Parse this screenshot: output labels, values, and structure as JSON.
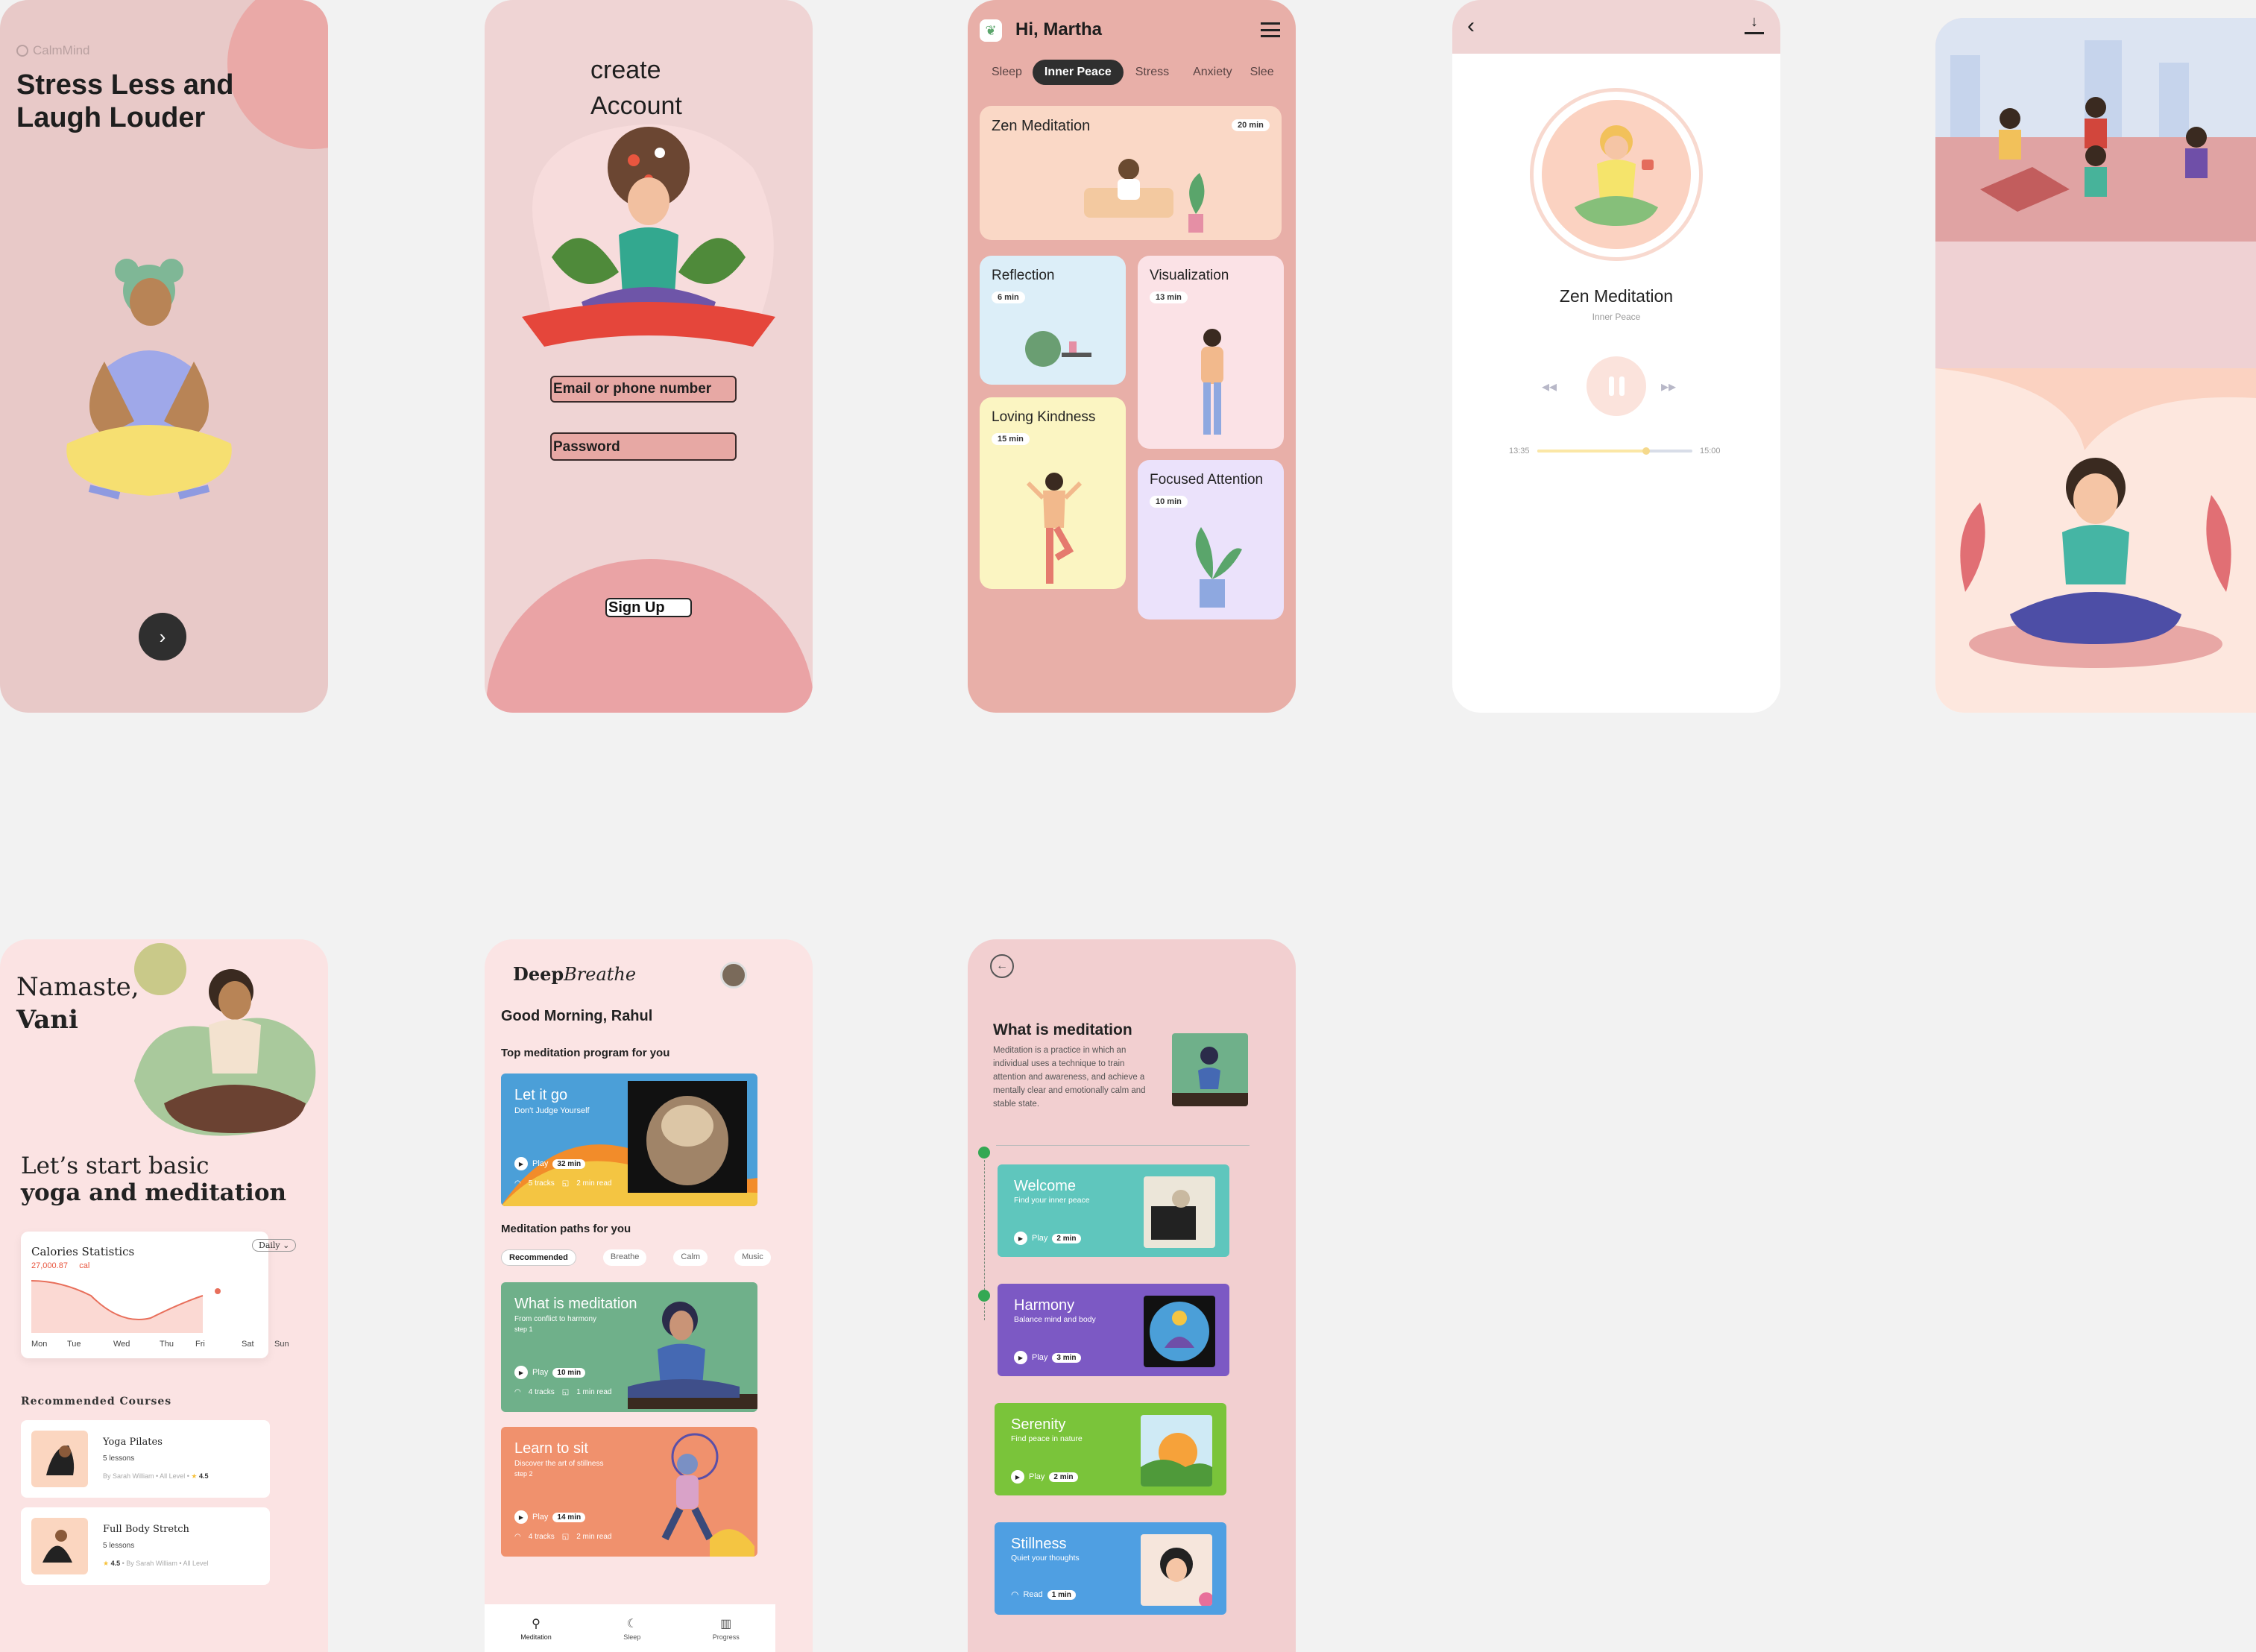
{
  "colors": {
    "background": "#f2f2f2",
    "pink": "#efcfcf",
    "salmon": "#e9b2a9",
    "dark": "#2f2f2f",
    "accent": "#e86f5b"
  },
  "s1": {
    "logo": "CalmMind",
    "title_line1": "Stress Less and",
    "title_line2": "Laugh Louder",
    "next_icon": "chevron-right-icon"
  },
  "s2": {
    "title_line1": "create",
    "title_line2": "Account",
    "email_placeholder": "Email or phone number",
    "password_placeholder": "Password",
    "signup": "Sign Up"
  },
  "s3": {
    "greeting": "Hi, Martha",
    "menu_icon": "hamburger-icon",
    "tabs": [
      "Sleep",
      "Inner Peace",
      "Stress",
      "Anxiety",
      "Slee"
    ],
    "active_tab": "Inner Peace",
    "cards": [
      {
        "title": "Zen Meditation",
        "duration": "20 min"
      },
      {
        "title": "Reflection",
        "duration": "6 min"
      },
      {
        "title": "Visualization",
        "duration": "13 min"
      },
      {
        "title": "Loving Kindness",
        "duration": "15 min"
      },
      {
        "title": "Focused Attention",
        "duration": "10 min"
      }
    ]
  },
  "s4": {
    "title": "Zen Meditation",
    "subtitle": "Inner Peace",
    "time_current": "13:35",
    "time_total": "15:00",
    "progress": 0.7
  },
  "s6": {
    "greeting_line1": "Namaste,",
    "greeting_name": "Vani",
    "headline_line1": "Let’s start basic",
    "headline_line2": "yoga and meditation",
    "stats_title": "Calories Statistics",
    "stats_value": "27,000.87",
    "stats_unit": "cal",
    "stats_filter": "Daily",
    "days": [
      "Mon",
      "Tue",
      "Wed",
      "Thu",
      "Fri",
      "Sat",
      "Sun"
    ],
    "section_title": "Recommended Courses",
    "courses": [
      {
        "title": "Yoga Pilates",
        "lessons": "5 lessons",
        "meta": "By Sarah William  •  All Level  •",
        "rating": "4.5"
      },
      {
        "title": "Full Body Stretch",
        "lessons": "5 lessons",
        "rating": "4.5",
        "meta": "By Sarah William  •  All Level"
      }
    ]
  },
  "s7": {
    "brand_a": "Deep",
    "brand_b": "Breathe",
    "greeting": "Good Morning, Rahul",
    "top_title": "Top meditation program for you",
    "featured": {
      "title": "Let it go",
      "subtitle": "Don't Judge Yourself",
      "play": "Play",
      "duration": "32 min",
      "tracks": "5 tracks",
      "read": "2 min read"
    },
    "paths_title": "Meditation paths for you",
    "chips": [
      "Recommended",
      "Breathe",
      "Calm",
      "Music"
    ],
    "cards": [
      {
        "title": "What is meditation",
        "subtitle": "From conflict to harmony",
        "step": "step 1",
        "play": "Play",
        "duration": "10 min",
        "tracks": "4 tracks",
        "read": "1 min read"
      },
      {
        "title": "Learn to sit",
        "subtitle": "Discover the art of stillness",
        "step": "step 2",
        "play": "Play",
        "duration": "14 min",
        "tracks": "4 tracks",
        "read": "2 min read"
      }
    ],
    "nav": [
      "Meditation",
      "Sleep",
      "Progress"
    ]
  },
  "s8": {
    "title": "What is meditation",
    "desc": "Meditation is a practice in which an individual uses a technique to train attention and awareness, and achieve a mentally clear and emotionally calm and stable state.",
    "items": [
      {
        "title": "Welcome",
        "subtitle": "Find your inner peace",
        "action": "Play",
        "duration": "2 min"
      },
      {
        "title": "Harmony",
        "subtitle": "Balance mind and body",
        "action": "Play",
        "duration": "3 min"
      },
      {
        "title": "Serenity",
        "subtitle": "Find peace in nature",
        "action": "Play",
        "duration": "2 min"
      },
      {
        "title": "Stillness",
        "subtitle": "Quiet your thoughts",
        "action": "Read",
        "duration": "1 min"
      }
    ]
  }
}
